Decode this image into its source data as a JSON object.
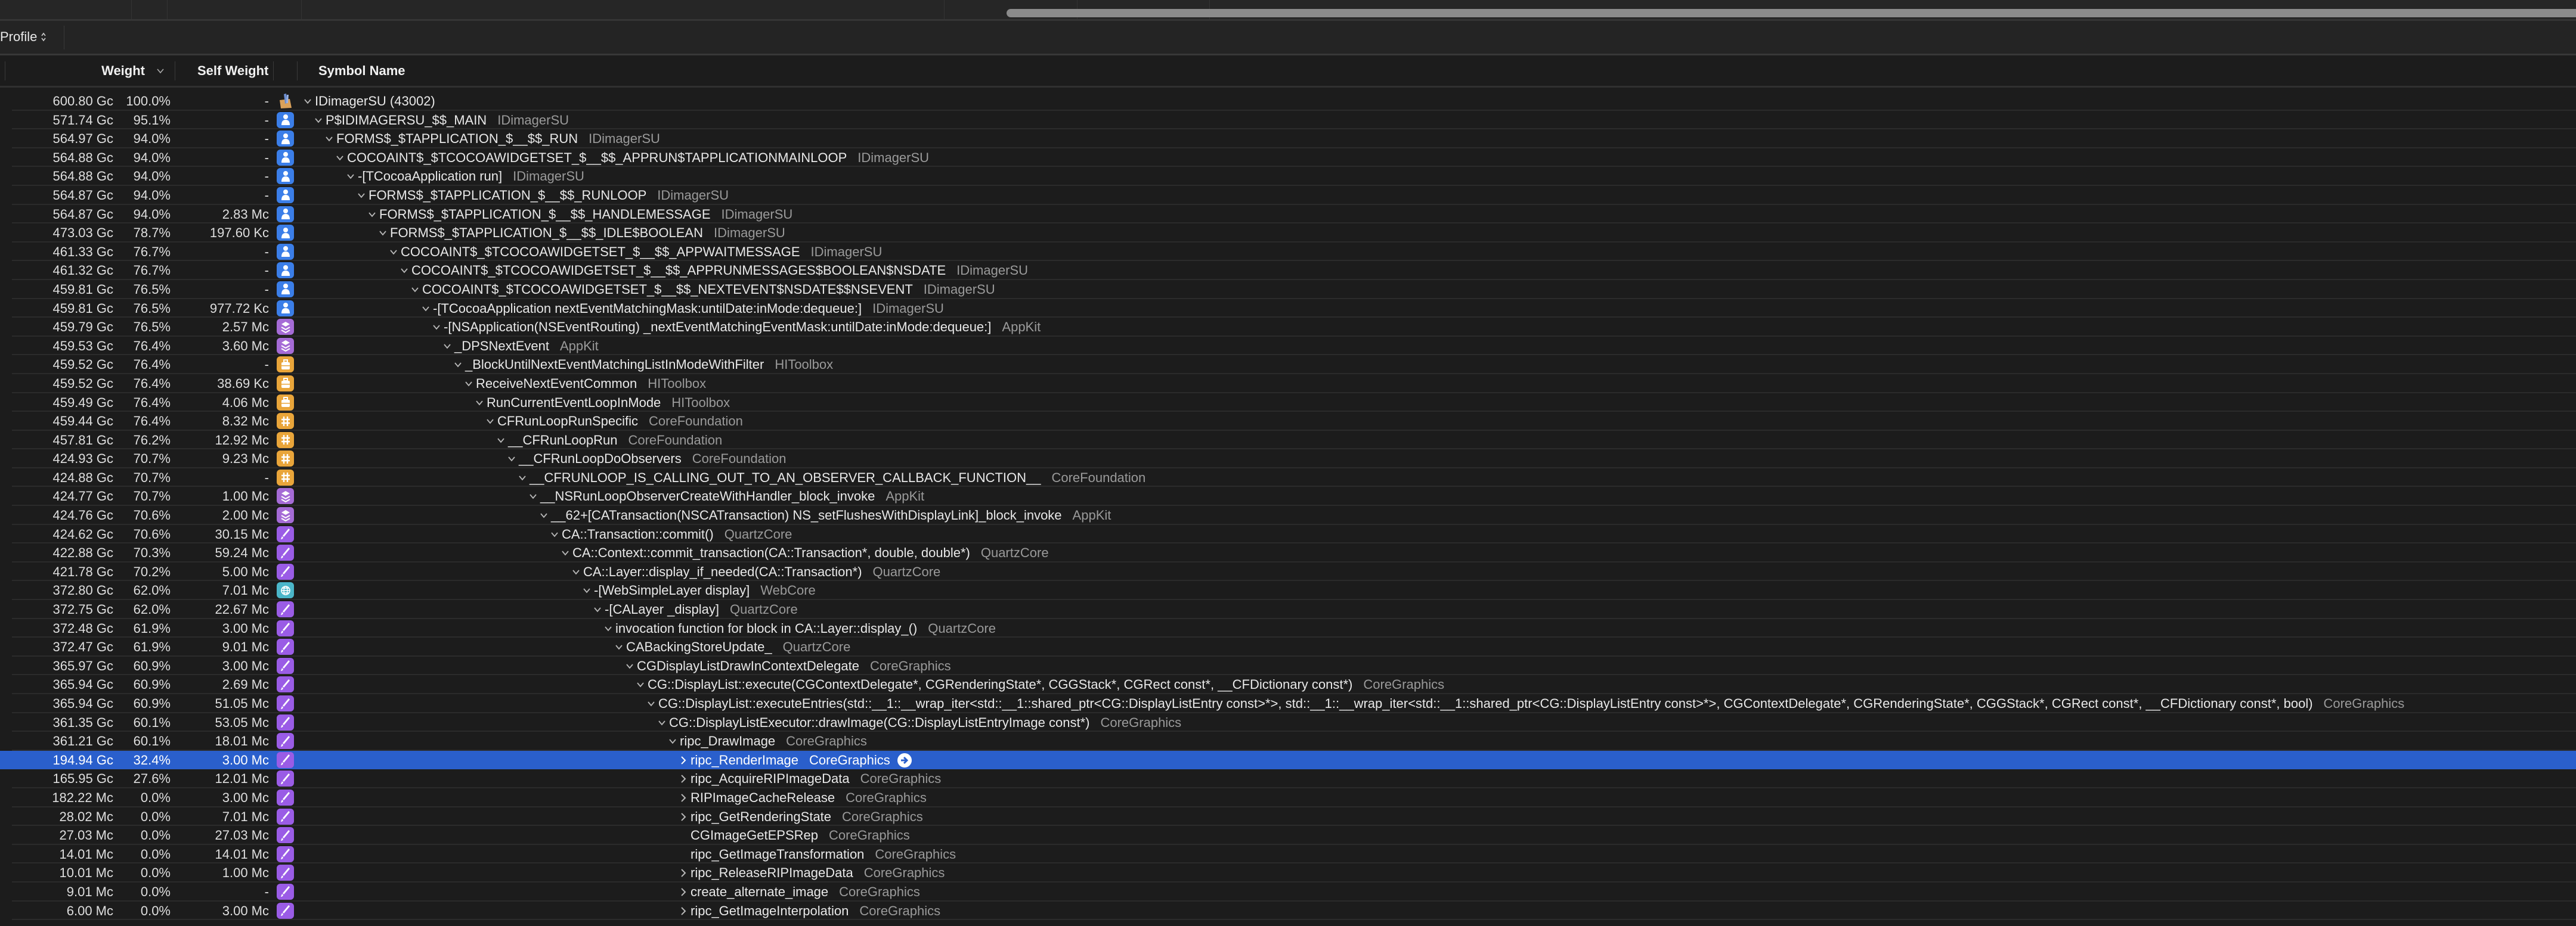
{
  "toolbar": {
    "profile_selector": "Profile"
  },
  "columns": {
    "weight": "Weight",
    "self_weight": "Self Weight",
    "symbol_name": "Symbol Name"
  },
  "colors": {
    "selection": "#2a5fcc",
    "user_icon": "#3b7ee8",
    "appkit_icon": "#a56bd6",
    "hitoolbox_icon": "#e9a53a",
    "corefoundation_icon": "#e9a53a",
    "quartz_icon": "#9a5ce6",
    "webcore_icon": "#4bb6c9"
  },
  "rows": [
    {
      "weight": "600.80 Gc",
      "percent": "100.0%",
      "self": "-",
      "icon": "app-icon",
      "symbol": "IDimagerSU (43002)",
      "library": "",
      "state": "open"
    },
    {
      "weight": "571.74 Gc",
      "percent": "95.1%",
      "self": "-",
      "icon": "user-icon",
      "symbol": "P$IDIMAGERSU_$$_MAIN",
      "library": "IDimagerSU",
      "state": "open"
    },
    {
      "weight": "564.97 Gc",
      "percent": "94.0%",
      "self": "-",
      "icon": "user-icon",
      "symbol": "FORMS$_$TAPPLICATION_$__$$_RUN",
      "library": "IDimagerSU",
      "state": "open"
    },
    {
      "weight": "564.88 Gc",
      "percent": "94.0%",
      "self": "-",
      "icon": "user-icon",
      "symbol": "COCOAINT$_$TCOCOAWIDGETSET_$__$$_APPRUN$TAPPLICATIONMAINLOOP",
      "library": "IDimagerSU",
      "state": "open"
    },
    {
      "weight": "564.88 Gc",
      "percent": "94.0%",
      "self": "-",
      "icon": "user-icon",
      "symbol": "-[TCocoaApplication run]",
      "library": "IDimagerSU",
      "state": "open"
    },
    {
      "weight": "564.87 Gc",
      "percent": "94.0%",
      "self": "-",
      "icon": "user-icon",
      "symbol": "FORMS$_$TAPPLICATION_$__$$_RUNLOOP",
      "library": "IDimagerSU",
      "state": "open"
    },
    {
      "weight": "564.87 Gc",
      "percent": "94.0%",
      "self": "2.83 Mc",
      "icon": "user-icon",
      "symbol": "FORMS$_$TAPPLICATION_$__$$_HANDLEMESSAGE",
      "library": "IDimagerSU",
      "state": "open"
    },
    {
      "weight": "473.03 Gc",
      "percent": "78.7%",
      "self": "197.60 Kc",
      "icon": "user-icon",
      "symbol": "FORMS$_$TAPPLICATION_$__$$_IDLE$BOOLEAN",
      "library": "IDimagerSU",
      "state": "open"
    },
    {
      "weight": "461.33 Gc",
      "percent": "76.7%",
      "self": "-",
      "icon": "user-icon",
      "symbol": "COCOAINT$_$TCOCOAWIDGETSET_$__$$_APPWAITMESSAGE",
      "library": "IDimagerSU",
      "state": "open"
    },
    {
      "weight": "461.32 Gc",
      "percent": "76.7%",
      "self": "-",
      "icon": "user-icon",
      "symbol": "COCOAINT$_$TCOCOAWIDGETSET_$__$$_APPRUNMESSAGES$BOOLEAN$NSDATE",
      "library": "IDimagerSU",
      "state": "open"
    },
    {
      "weight": "459.81 Gc",
      "percent": "76.5%",
      "self": "-",
      "icon": "user-icon",
      "symbol": "COCOAINT$_$TCOCOAWIDGETSET_$__$$_NEXTEVENT$NSDATE$$NSEVENT",
      "library": "IDimagerSU",
      "state": "open"
    },
    {
      "weight": "459.81 Gc",
      "percent": "76.5%",
      "self": "977.72 Kc",
      "icon": "user-icon",
      "symbol": "-[TCocoaApplication nextEventMatchingMask:untilDate:inMode:dequeue:]",
      "library": "IDimagerSU",
      "state": "open"
    },
    {
      "weight": "459.79 Gc",
      "percent": "76.5%",
      "self": "2.57 Mc",
      "icon": "layers-icon",
      "symbol": "-[NSApplication(NSEventRouting) _nextEventMatchingEventMask:untilDate:inMode:dequeue:]",
      "library": "AppKit",
      "state": "open"
    },
    {
      "weight": "459.53 Gc",
      "percent": "76.4%",
      "self": "3.60 Mc",
      "icon": "layers-icon",
      "symbol": "_DPSNextEvent",
      "library": "AppKit",
      "state": "open"
    },
    {
      "weight": "459.52 Gc",
      "percent": "76.4%",
      "self": "-",
      "icon": "toolbox-icon",
      "symbol": "_BlockUntilNextEventMatchingListInModeWithFilter",
      "library": "HIToolbox",
      "state": "open"
    },
    {
      "weight": "459.52 Gc",
      "percent": "76.4%",
      "self": "38.69 Kc",
      "icon": "toolbox-icon",
      "symbol": "ReceiveNextEventCommon",
      "library": "HIToolbox",
      "state": "open"
    },
    {
      "weight": "459.49 Gc",
      "percent": "76.4%",
      "self": "4.06 Mc",
      "icon": "toolbox-icon",
      "symbol": "RunCurrentEventLoopInMode",
      "library": "HIToolbox",
      "state": "open"
    },
    {
      "weight": "459.44 Gc",
      "percent": "76.4%",
      "self": "8.32 Mc",
      "icon": "foundation-icon",
      "symbol": "CFRunLoopRunSpecific",
      "library": "CoreFoundation",
      "state": "open"
    },
    {
      "weight": "457.81 Gc",
      "percent": "76.2%",
      "self": "12.92 Mc",
      "icon": "foundation-icon",
      "symbol": "__CFRunLoopRun",
      "library": "CoreFoundation",
      "state": "open"
    },
    {
      "weight": "424.93 Gc",
      "percent": "70.7%",
      "self": "9.23 Mc",
      "icon": "foundation-icon",
      "symbol": "__CFRunLoopDoObservers",
      "library": "CoreFoundation",
      "state": "open"
    },
    {
      "weight": "424.88 Gc",
      "percent": "70.7%",
      "self": "-",
      "icon": "foundation-icon",
      "symbol": "__CFRUNLOOP_IS_CALLING_OUT_TO_AN_OBSERVER_CALLBACK_FUNCTION__",
      "library": "CoreFoundation",
      "state": "open"
    },
    {
      "weight": "424.77 Gc",
      "percent": "70.7%",
      "self": "1.00 Mc",
      "icon": "layers-icon",
      "symbol": "__NSRunLoopObserverCreateWithHandler_block_invoke",
      "library": "AppKit",
      "state": "open"
    },
    {
      "weight": "424.76 Gc",
      "percent": "70.6%",
      "self": "2.00 Mc",
      "icon": "layers-icon",
      "symbol": "__62+[CATransaction(NSCATransaction) NS_setFlushesWithDisplayLink]_block_invoke",
      "library": "AppKit",
      "state": "open"
    },
    {
      "weight": "424.62 Gc",
      "percent": "70.6%",
      "self": "30.15 Mc",
      "icon": "brush-icon",
      "symbol": "CA::Transaction::commit()",
      "library": "QuartzCore",
      "state": "open"
    },
    {
      "weight": "422.88 Gc",
      "percent": "70.3%",
      "self": "59.24 Mc",
      "icon": "brush-icon",
      "symbol": "CA::Context::commit_transaction(CA::Transaction*, double, double*)",
      "library": "QuartzCore",
      "state": "open"
    },
    {
      "weight": "421.78 Gc",
      "percent": "70.2%",
      "self": "5.00 Mc",
      "icon": "brush-icon",
      "symbol": "CA::Layer::display_if_needed(CA::Transaction*)",
      "library": "QuartzCore",
      "state": "open"
    },
    {
      "weight": "372.80 Gc",
      "percent": "62.0%",
      "self": "7.01 Mc",
      "icon": "globe-icon",
      "symbol": "-[WebSimpleLayer display]",
      "library": "WebCore",
      "state": "open"
    },
    {
      "weight": "372.75 Gc",
      "percent": "62.0%",
      "self": "22.67 Mc",
      "icon": "brush-icon",
      "symbol": "-[CALayer _display]",
      "library": "QuartzCore",
      "state": "open"
    },
    {
      "weight": "372.48 Gc",
      "percent": "61.9%",
      "self": "3.00 Mc",
      "icon": "brush-icon",
      "symbol": "invocation function for block in CA::Layer::display_()",
      "library": "QuartzCore",
      "state": "open"
    },
    {
      "weight": "372.47 Gc",
      "percent": "61.9%",
      "self": "9.01 Mc",
      "icon": "brush-icon",
      "symbol": "CABackingStoreUpdate_",
      "library": "QuartzCore",
      "state": "open"
    },
    {
      "weight": "365.97 Gc",
      "percent": "60.9%",
      "self": "3.00 Mc",
      "icon": "brush-icon",
      "symbol": "CGDisplayListDrawInContextDelegate",
      "library": "CoreGraphics",
      "state": "open"
    },
    {
      "weight": "365.94 Gc",
      "percent": "60.9%",
      "self": "2.69 Mc",
      "icon": "brush-icon",
      "symbol": "CG::DisplayList::execute(CGContextDelegate*, CGRenderingState*, CGGStack*, CGRect const*, __CFDictionary const*)",
      "library": "CoreGraphics",
      "state": "open"
    },
    {
      "weight": "365.94 Gc",
      "percent": "60.9%",
      "self": "51.05 Mc",
      "icon": "brush-icon",
      "symbol": "CG::DisplayList::executeEntries(std::__1::__wrap_iter<std::__1::shared_ptr<CG::DisplayListEntry const>*>, std::__1::__wrap_iter<std::__1::shared_ptr<CG::DisplayListEntry const>*>, CGContextDelegate*, CGRenderingState*, CGGStack*, CGRect const*, __CFDictionary const*, bool)",
      "library": "CoreGraphics",
      "state": "open"
    },
    {
      "weight": "361.35 Gc",
      "percent": "60.1%",
      "self": "53.05 Mc",
      "icon": "brush-icon",
      "symbol": "CG::DisplayListExecutor::drawImage(CG::DisplayListEntryImage const*)",
      "library": "CoreGraphics",
      "state": "open"
    },
    {
      "weight": "361.21 Gc",
      "percent": "60.1%",
      "self": "18.01 Mc",
      "icon": "brush-icon",
      "symbol": "ripc_DrawImage",
      "library": "CoreGraphics",
      "state": "open"
    },
    {
      "weight": "194.94 Gc",
      "percent": "32.4%",
      "self": "3.00 Mc",
      "icon": "brush-icon",
      "symbol": "ripc_RenderImage",
      "library": "CoreGraphics",
      "state": "closed",
      "selected": true
    },
    {
      "weight": "165.95 Gc",
      "percent": "27.6%",
      "self": "12.01 Mc",
      "icon": "brush-icon",
      "symbol": "ripc_AcquireRIPImageData",
      "library": "CoreGraphics",
      "state": "closed"
    },
    {
      "weight": "182.22 Mc",
      "percent": "0.0%",
      "self": "3.00 Mc",
      "icon": "brush-icon",
      "symbol": "RIPImageCacheRelease",
      "library": "CoreGraphics",
      "state": "closed"
    },
    {
      "weight": "28.02 Mc",
      "percent": "0.0%",
      "self": "7.01 Mc",
      "icon": "brush-icon",
      "symbol": "ripc_GetRenderingState",
      "library": "CoreGraphics",
      "state": "closed"
    },
    {
      "weight": "27.03 Mc",
      "percent": "0.0%",
      "self": "27.03 Mc",
      "icon": "brush-icon",
      "symbol": "CGImageGetEPSRep",
      "library": "CoreGraphics",
      "state": "none"
    },
    {
      "weight": "14.01 Mc",
      "percent": "0.0%",
      "self": "14.01 Mc",
      "icon": "brush-icon",
      "symbol": "ripc_GetImageTransformation",
      "library": "CoreGraphics",
      "state": "none"
    },
    {
      "weight": "10.01 Mc",
      "percent": "0.0%",
      "self": "1.00 Mc",
      "icon": "brush-icon",
      "symbol": "ripc_ReleaseRIPImageData",
      "library": "CoreGraphics",
      "state": "closed"
    },
    {
      "weight": "9.01 Mc",
      "percent": "0.0%",
      "self": "-",
      "icon": "brush-icon",
      "symbol": "create_alternate_image",
      "library": "CoreGraphics",
      "state": "closed"
    },
    {
      "weight": "6.00 Mc",
      "percent": "0.0%",
      "self": "3.00 Mc",
      "icon": "brush-icon",
      "symbol": "ripc_GetImageInterpolation",
      "library": "CoreGraphics",
      "state": "closed"
    }
  ]
}
